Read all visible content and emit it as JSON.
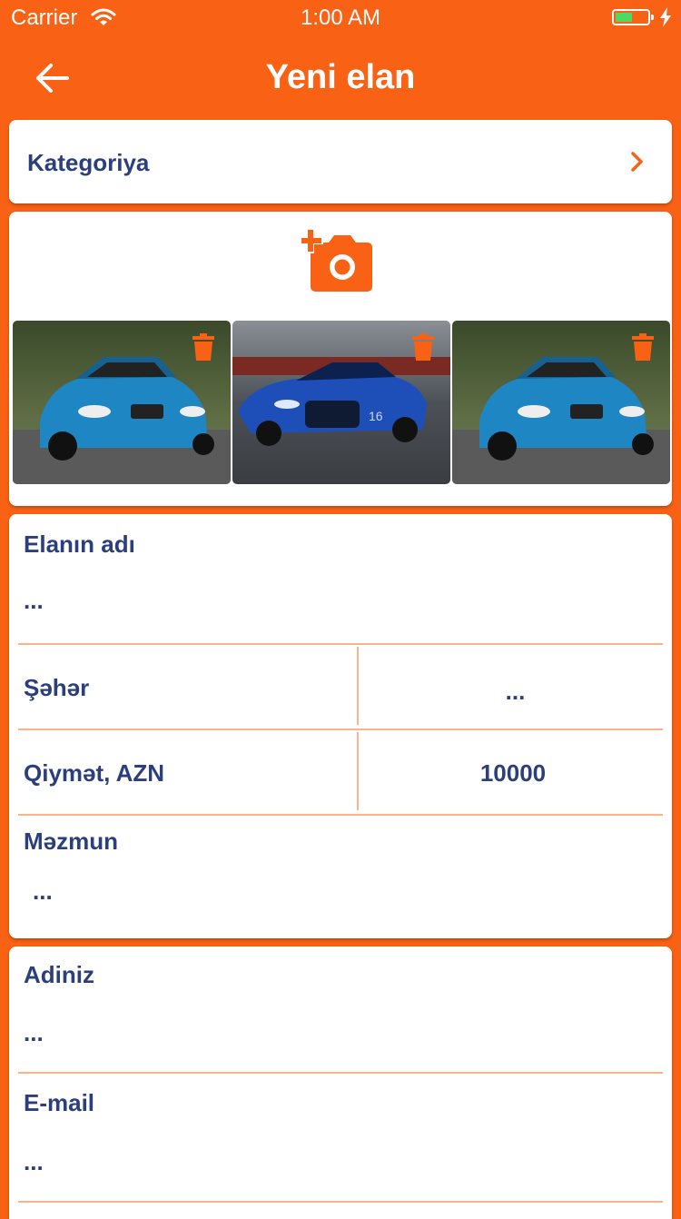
{
  "status_bar": {
    "carrier": "Carrier",
    "time": "1:00 AM"
  },
  "nav": {
    "title": "Yeni elan",
    "back_icon": "arrow-left-icon"
  },
  "category": {
    "label": "Kategoriya",
    "icon": "chevron-right-icon"
  },
  "photos": {
    "add_icon": "add-photo-icon",
    "items": [
      {
        "subject": "blue-bmw-car",
        "delete_icon": "trash-icon"
      },
      {
        "subject": "blue-bugatti-car",
        "delete_icon": "trash-icon"
      },
      {
        "subject": "blue-bmw-car",
        "delete_icon": "trash-icon"
      }
    ]
  },
  "form": {
    "title_label": "Elanın adı",
    "title_value": "...",
    "city_label": "Şəhər",
    "city_value": "...",
    "price_label": "Qiymət, AZN",
    "price_value": "10000",
    "content_label": "Məzmun",
    "content_value": "..."
  },
  "contact": {
    "name_label": "Adiniz",
    "name_value": "...",
    "email_label": "E-mail",
    "email_value": "..."
  },
  "colors": {
    "accent": "#f96115",
    "text": "#2b3f7c",
    "separator": "#f7b48d"
  }
}
